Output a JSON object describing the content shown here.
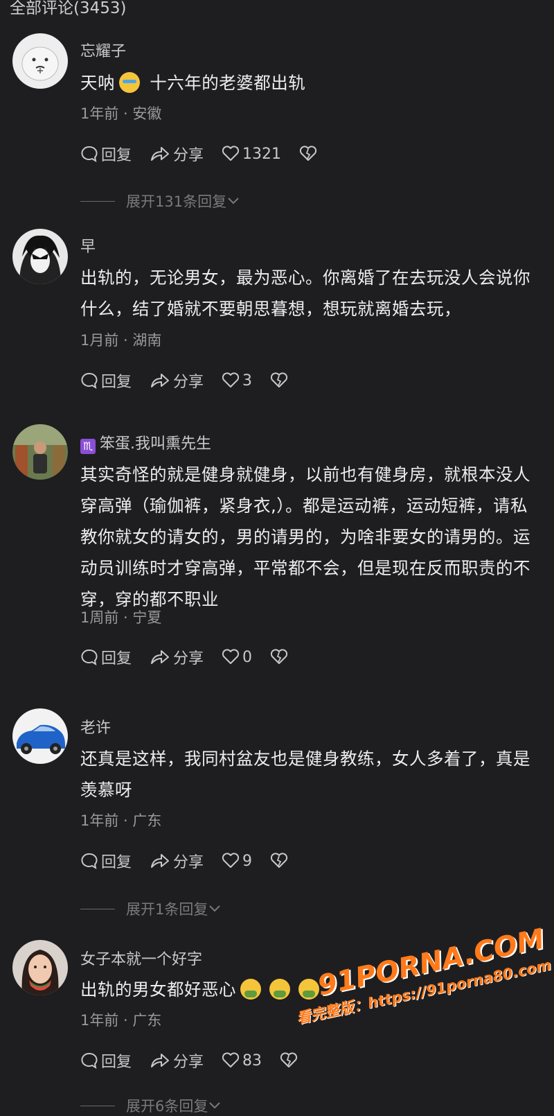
{
  "header": {
    "title": "全部评论(3453)"
  },
  "labels": {
    "reply": "回复",
    "share": "分享"
  },
  "comments": [
    {
      "name": "忘耀子",
      "text_before": "天呐",
      "emoji": "crying-face",
      "text_after": " 十六年的老婆都出轨",
      "meta": "1年前 · 安徽",
      "likes": "1321",
      "expand": "展开131条回复"
    },
    {
      "name": "早",
      "text": "出轨的，无论男女，最为恶心。你离婚了在去玩没人会说你什么，结了婚就不要朝思暮想，想玩就离婚去玩，",
      "meta": "1月前 · 湖南",
      "likes": "3"
    },
    {
      "badge": "♏",
      "name": "笨蛋.我叫熏先生",
      "text": "其实奇怪的就是健身就健身，以前也有健身房，就根本没人穿高弹（瑜伽裤，紧身衣,）。都是运动裤，运动短裤，请私教你就女的请女的，男的请男的，为啥非要女的请男的。运动员训练时才穿高弹，平常都不会，但是现在反而职责的不穿，穿的都不职业",
      "meta": "1周前 · 宁夏",
      "likes": "0"
    },
    {
      "name": "老许",
      "text": "还真是这样，我同村盆友也是健身教练，女人多着了，真是羡慕呀",
      "meta": "1年前 · 广东",
      "likes": "9",
      "expand": "展开1条回复"
    },
    {
      "name": "女子本就一个好字",
      "text_before": "出轨的男女都好恶心",
      "emoji": "nauseated-face",
      "meta": "1年前 · 广东",
      "likes": "83",
      "expand": "展开6条回复"
    }
  ],
  "watermark": {
    "logo": "91PORNA.COM",
    "line": "看完整版：https://91porna80.com"
  },
  "colors": {
    "background": "#1e1e20",
    "text": "#ededed",
    "meta": "#9a9a9a",
    "watermark": "#ff7a1a"
  }
}
